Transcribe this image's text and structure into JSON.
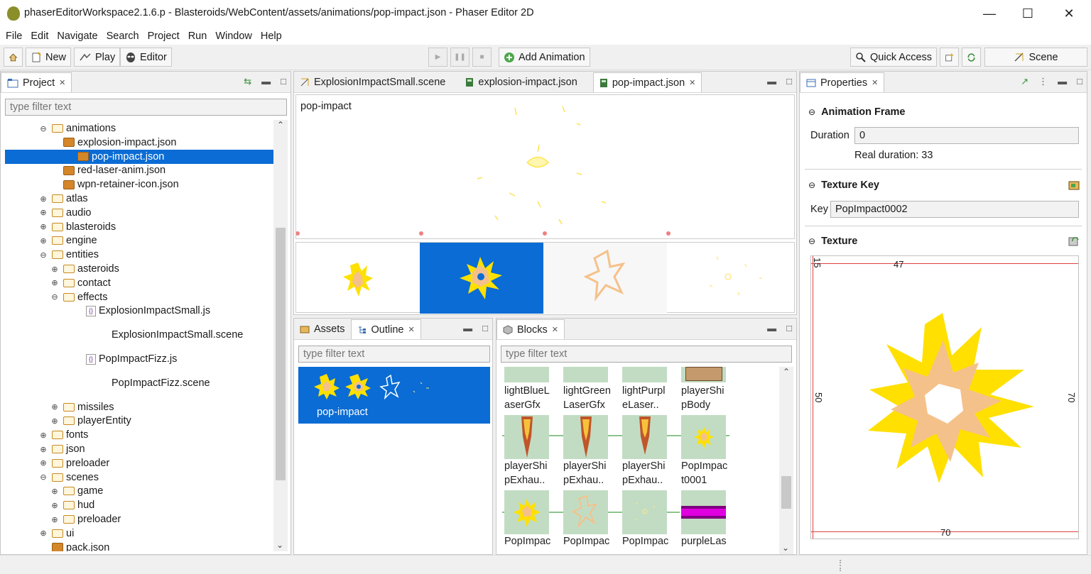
{
  "window": {
    "title": "phaserEditorWorkspace2.1.6.p - Blasteroids/WebContent/assets/animations/pop-impact.json - Phaser Editor 2D"
  },
  "menu": [
    "File",
    "Edit",
    "Navigate",
    "Search",
    "Project",
    "Run",
    "Window",
    "Help"
  ],
  "toolbar": {
    "new": "New",
    "play": "Play",
    "editor": "Editor",
    "add_animation": "Add Animation",
    "quick_access": "Quick Access",
    "scene": "Scene"
  },
  "project": {
    "tab": "Project",
    "filter_placeholder": "type filter text",
    "tree": [
      {
        "label": "animations",
        "depth": 0,
        "kind": "folder",
        "toggle": "⊖"
      },
      {
        "label": "explosion-impact.json",
        "depth": 1,
        "kind": "json"
      },
      {
        "label": "pop-impact.json",
        "depth": 1,
        "kind": "json",
        "selected": true
      },
      {
        "label": "red-laser-anim.json",
        "depth": 1,
        "kind": "json"
      },
      {
        "label": "wpn-retainer-icon.json",
        "depth": 1,
        "kind": "json"
      },
      {
        "label": "atlas",
        "depth": 0,
        "kind": "folder",
        "toggle": "⊕"
      },
      {
        "label": "audio",
        "depth": 0,
        "kind": "folder",
        "toggle": "⊕"
      },
      {
        "label": "blasteroids",
        "depth": 0,
        "kind": "folder",
        "toggle": "⊕"
      },
      {
        "label": "engine",
        "depth": 0,
        "kind": "folder",
        "toggle": "⊕"
      },
      {
        "label": "entities",
        "depth": 0,
        "kind": "folder",
        "toggle": "⊖"
      },
      {
        "label": "asteroids",
        "depth": 1,
        "kind": "folder",
        "toggle": "⊕"
      },
      {
        "label": "contact",
        "depth": 1,
        "kind": "folder",
        "toggle": "⊕"
      },
      {
        "label": "effects",
        "depth": 1,
        "kind": "folder",
        "toggle": "⊖"
      },
      {
        "label": "ExplosionImpactSmall.js",
        "depth": 2,
        "kind": "js"
      },
      {
        "label": "ExplosionImpactSmall.scene",
        "depth": 3,
        "kind": "scene",
        "tall": true
      },
      {
        "label": "PopImpactFizz.js",
        "depth": 2,
        "kind": "js",
        "tall": true
      },
      {
        "label": "PopImpactFizz.scene",
        "depth": 3,
        "kind": "scene",
        "tall": true
      },
      {
        "label": "missiles",
        "depth": 1,
        "kind": "folder",
        "toggle": "⊕",
        "tall": true
      },
      {
        "label": "playerEntity",
        "depth": 1,
        "kind": "folder",
        "toggle": "⊕"
      },
      {
        "label": "fonts",
        "depth": 0,
        "kind": "folder",
        "toggle": "⊕"
      },
      {
        "label": "json",
        "depth": 0,
        "kind": "folder",
        "toggle": "⊕"
      },
      {
        "label": "preloader",
        "depth": 0,
        "kind": "folder",
        "toggle": "⊕"
      },
      {
        "label": "scenes",
        "depth": 0,
        "kind": "folder",
        "toggle": "⊖"
      },
      {
        "label": "game",
        "depth": 1,
        "kind": "folder",
        "toggle": "⊕"
      },
      {
        "label": "hud",
        "depth": 1,
        "kind": "folder",
        "toggle": "⊕"
      },
      {
        "label": "preloader",
        "depth": 1,
        "kind": "folder",
        "toggle": "⊕"
      },
      {
        "label": "ui",
        "depth": 0,
        "kind": "folder",
        "toggle": "⊕"
      },
      {
        "label": "pack.json",
        "depth": 0,
        "kind": "json"
      }
    ]
  },
  "editor": {
    "tabs": [
      {
        "label": "ExplosionImpactSmall.scene"
      },
      {
        "label": "explosion-impact.json"
      },
      {
        "label": "pop-impact.json",
        "active": true
      }
    ],
    "animation_name": "pop-impact"
  },
  "outline": {
    "tabs": [
      "Assets",
      "Outline"
    ],
    "filter_placeholder": "type filter text",
    "item": "pop-impact"
  },
  "blocks": {
    "tab": "Blocks",
    "filter_placeholder": "type filter text",
    "row1": [
      "lightBlueLaserGfx",
      "lightGreenLaserGfx",
      "lightPurpleLaser..",
      "playerShipBody"
    ],
    "row2": [
      "playerShipExhau..",
      "playerShipExhau..",
      "playerShipExhau..",
      "PopImpact0001"
    ],
    "row3": [
      "PopImpac",
      "PopImpac",
      "PopImpac",
      "purpleLas"
    ]
  },
  "properties": {
    "tab": "Properties",
    "frame_section": "Animation Frame",
    "duration_label": "Duration",
    "duration_value": "0",
    "real_duration": "Real duration: 33",
    "key_section": "Texture Key",
    "key_label": "Key",
    "key_value": "PopImpact0002",
    "texture_section": "Texture",
    "tex_top": "47",
    "tex_left": "50",
    "tex_right": "70",
    "tex_bottom": "70",
    "tex_corner": "15"
  },
  "colors": {
    "selection": "#0a6cd4",
    "thumb_bg": "#c2dcc3",
    "burst_yellow": "#ffe000",
    "burst_orange": "#f5c18a"
  }
}
